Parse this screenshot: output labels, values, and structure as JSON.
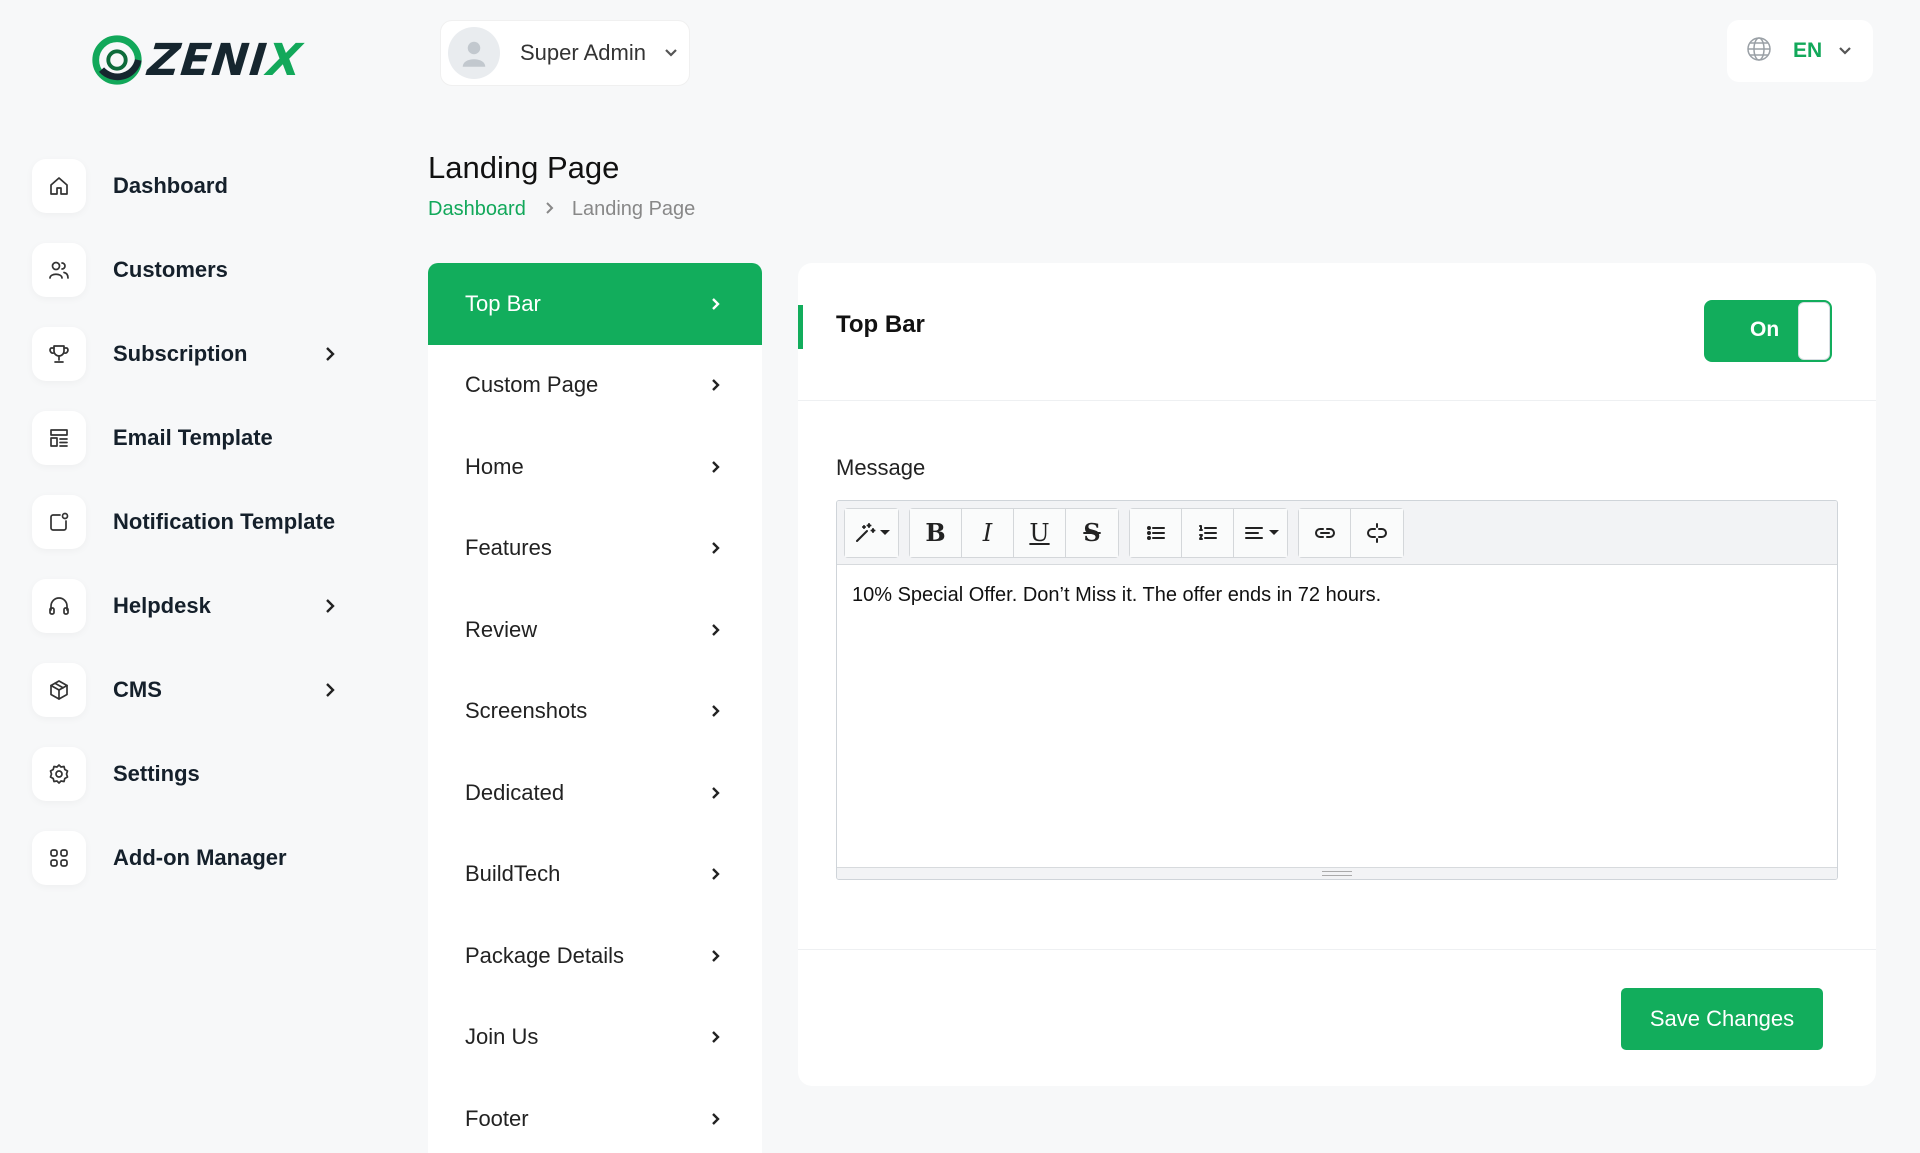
{
  "brand": {
    "logo_text_dark": "ZENI",
    "logo_text_accent": "X"
  },
  "header": {
    "user_name": "Super Admin",
    "language": "EN"
  },
  "sidebar": {
    "items": [
      {
        "label": "Dashboard",
        "icon": "home-icon",
        "has_submenu": false
      },
      {
        "label": "Customers",
        "icon": "users-icon",
        "has_submenu": false
      },
      {
        "label": "Subscription",
        "icon": "trophy-icon",
        "has_submenu": true
      },
      {
        "label": "Email Template",
        "icon": "template-icon",
        "has_submenu": false
      },
      {
        "label": "Notification Template",
        "icon": "notification-icon",
        "has_submenu": false
      },
      {
        "label": "Helpdesk",
        "icon": "headphones-icon",
        "has_submenu": true
      },
      {
        "label": "CMS",
        "icon": "box-icon",
        "has_submenu": true
      },
      {
        "label": "Settings",
        "icon": "gear-icon",
        "has_submenu": false
      },
      {
        "label": "Add-on Manager",
        "icon": "apps-icon",
        "has_submenu": false
      }
    ]
  },
  "page": {
    "title": "Landing Page",
    "breadcrumb": {
      "root": "Dashboard",
      "current": "Landing Page"
    }
  },
  "sections": {
    "active": "Top Bar",
    "items": [
      "Top Bar",
      "Custom Page",
      "Home",
      "Features",
      "Review",
      "Screenshots",
      "Dedicated",
      "BuildTech",
      "Package Details",
      "Join Us",
      "Footer"
    ]
  },
  "card": {
    "title": "Top Bar",
    "toggle_label": "On",
    "toggle_on": true,
    "message_label": "Message",
    "message_text": "10% Special Offer. Don’t Miss it. The offer ends in 72 hours.",
    "save_label": "Save Changes"
  },
  "toolbar": {
    "bold": "B",
    "italic": "I",
    "underline": "U",
    "strike": "S"
  },
  "colors": {
    "accent": "#12ad5c",
    "background": "#f7f8f9"
  }
}
